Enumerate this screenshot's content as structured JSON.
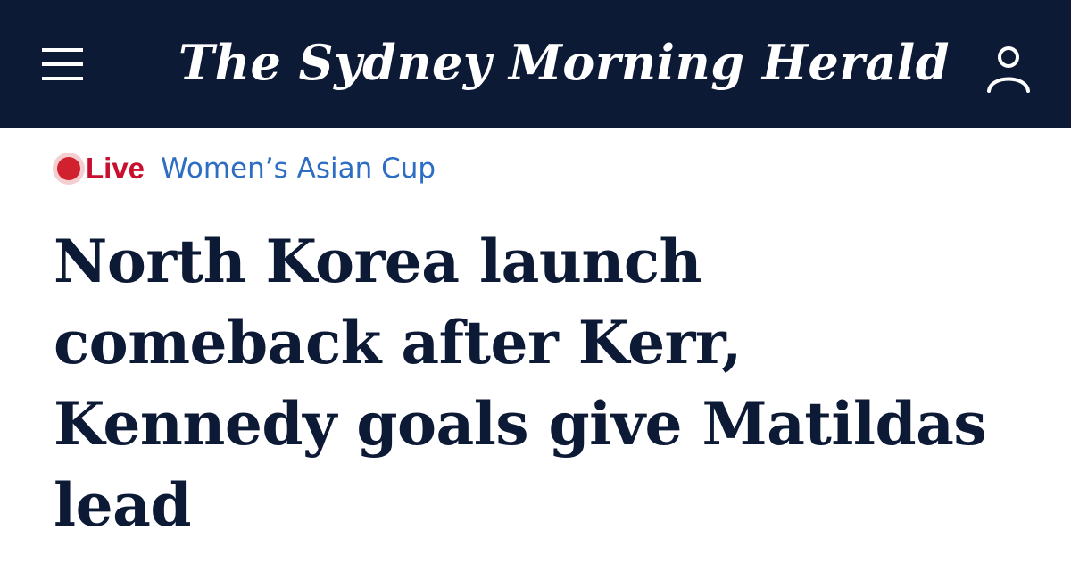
{
  "masthead": {
    "logo_text": "The Sydney Morning Herald",
    "menu_icon": "hamburger-menu-icon",
    "account_icon": "user-account-icon"
  },
  "kicker": {
    "live_label": "Live",
    "section": "Women’s Asian Cup"
  },
  "article": {
    "headline": "North Korea launch comeback after Kerr, Kennedy goals give Matildas lead"
  },
  "colors": {
    "masthead_bg": "#0d1a36",
    "live_red": "#c8102e",
    "section_blue": "#2e6dc4",
    "headline_navy": "#0d1a36"
  }
}
